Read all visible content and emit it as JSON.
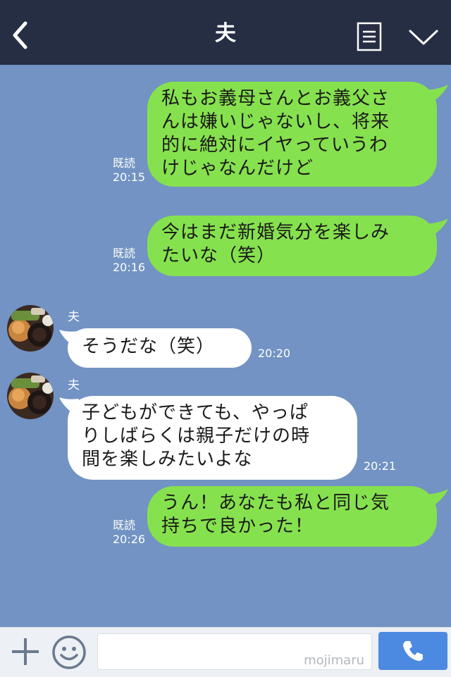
{
  "header": {
    "title": "夫"
  },
  "messages": [
    {
      "direction": "out",
      "text": "私もお義母さんとお義父さんは嫌いじゃないし、将来的に絶対にイヤっていうわけじゃなんだけど",
      "lines": [
        "私もお義母さんとお義父さ",
        "んは嫌いじゃないし、将来",
        "的に絶対にイヤっていうわ",
        "けじゃなんだけど"
      ],
      "read": "既読",
      "time": "20:15"
    },
    {
      "direction": "out",
      "text": "今はまだ新婚気分を楽しみたいな（笑）",
      "lines": [
        "今はまだ新婚気分を楽しみ",
        "たいな（笑）"
      ],
      "read": "既読",
      "time": "20:16"
    },
    {
      "direction": "in",
      "sender": "夫",
      "text": "そうだな（笑）",
      "lines": [
        "そうだな（笑）"
      ],
      "time": "20:20"
    },
    {
      "direction": "in",
      "sender": "夫",
      "text": "子どもができても、やっぱりしばらくは親子だけの時間を楽しみたいよな",
      "lines": [
        "子どもができても、やっぱ",
        "りしばらくは親子だけの時",
        "間を楽しみたいよな"
      ],
      "time": "20:21"
    },
    {
      "direction": "out",
      "text": "うん！あなたも私と同じ気持ちで良かった！",
      "lines": [
        "うん！あなたも私と同じ気",
        "持ちで良かった！"
      ],
      "read": "既読",
      "time": "20:26"
    }
  ],
  "footer": {
    "watermark": "mojimaru"
  },
  "colors": {
    "header_bg": "#252e43",
    "chat_bg": "#7293c3",
    "outgoing_bubble": "#86e14e",
    "incoming_bubble": "#ffffff",
    "call_button": "#4b8ae0"
  },
  "icons": [
    "back-icon",
    "menu-icon",
    "chevron-down-icon",
    "plus-icon",
    "smile-icon",
    "phone-icon"
  ]
}
